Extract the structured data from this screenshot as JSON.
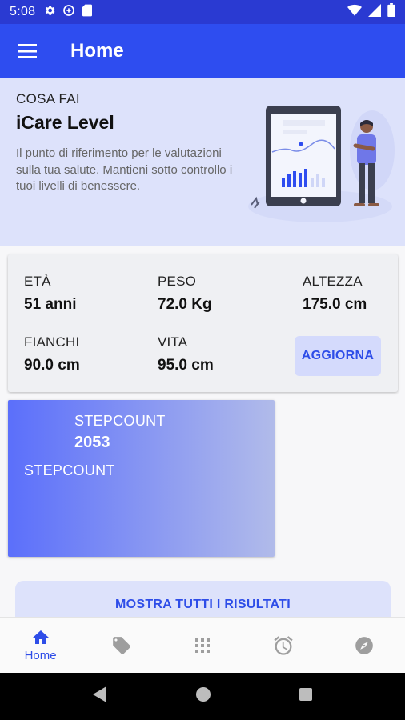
{
  "status_bar": {
    "time": "5:08"
  },
  "app_bar": {
    "title": "Home"
  },
  "hero": {
    "kicker": "COSA FAI",
    "heading": "iCare Level",
    "description": "Il punto di riferimento per le valutazioni sulla tua salute. Mantieni sotto controllo i tuoi livelli di benessere."
  },
  "profile": {
    "age": {
      "label": "ETÀ",
      "value": "51 anni"
    },
    "weight": {
      "label": "PESO",
      "value": "72.0 Kg"
    },
    "height": {
      "label": "ALTEZZA",
      "value": "175.0 cm"
    },
    "hips": {
      "label": "FIANCHI",
      "value": "90.0 cm"
    },
    "waist": {
      "label": "VITA",
      "value": "95.0 cm"
    },
    "update_label": "AGGIORNA"
  },
  "stepcount": {
    "label": "STEPCOUNT",
    "value": "2053",
    "subtitle": "STEPCOUNT"
  },
  "results_button": "MOSTRA TUTTI I RISULTATI",
  "bottom_nav": {
    "items": [
      {
        "icon": "home-icon",
        "label": "Home",
        "active": true
      },
      {
        "icon": "tag-icon"
      },
      {
        "icon": "grid-icon"
      },
      {
        "icon": "alarm-icon"
      },
      {
        "icon": "compass-icon"
      }
    ]
  },
  "colors": {
    "primary": "#2e4df0",
    "status_bar": "#2a3ad2",
    "hero_bg": "#dde2fb",
    "accent_text": "#2e4de8",
    "inactive_icon": "#9e9e9e"
  }
}
